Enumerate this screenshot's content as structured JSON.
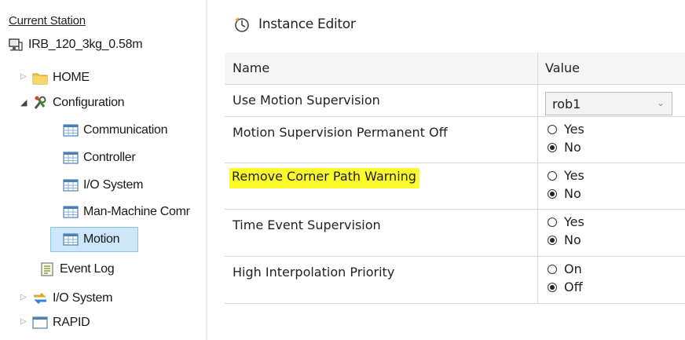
{
  "tree": {
    "header": "Current Station",
    "station": "IRB_120_3kg_0.58m",
    "nodes": [
      {
        "label": "HOME",
        "icon": "folder-icon"
      },
      {
        "label": "Configuration",
        "icon": "configuration-icon"
      },
      {
        "label": "Communication",
        "icon": "table-icon"
      },
      {
        "label": "Controller",
        "icon": "table-icon"
      },
      {
        "label": "I/O System",
        "icon": "table-icon"
      },
      {
        "label": "Man-Machine Comr",
        "icon": "table-icon"
      },
      {
        "label": "Motion",
        "icon": "table-icon",
        "selected": true
      },
      {
        "label": "Event Log",
        "icon": "event-log-icon"
      },
      {
        "label": "I/O System",
        "icon": "io-system-icon"
      },
      {
        "label": "RAPID",
        "icon": "rapid-icon"
      }
    ]
  },
  "editor": {
    "title": "Instance Editor",
    "columns": {
      "name": "Name",
      "value": "Value"
    },
    "rows": [
      {
        "name": "Use Motion Supervision",
        "type": "dropdown",
        "value": "rob1"
      },
      {
        "name": "Motion Supervision Permanent Off",
        "type": "radio",
        "options": [
          "Yes",
          "No"
        ],
        "selected": "No"
      },
      {
        "name": "Remove Corner Path Warning",
        "type": "radio",
        "options": [
          "Yes",
          "No"
        ],
        "selected": "No",
        "highlighted": true
      },
      {
        "name": "Time Event Supervision",
        "type": "radio",
        "options": [
          "Yes",
          "No"
        ],
        "selected": "No"
      },
      {
        "name": "High Interpolation Priority",
        "type": "radio",
        "options": [
          "On",
          "Off"
        ],
        "selected": "Off"
      }
    ]
  },
  "colors": {
    "highlight": "#fbfb2c",
    "selection": "#cce6fa",
    "folder": "#f4c84a"
  }
}
